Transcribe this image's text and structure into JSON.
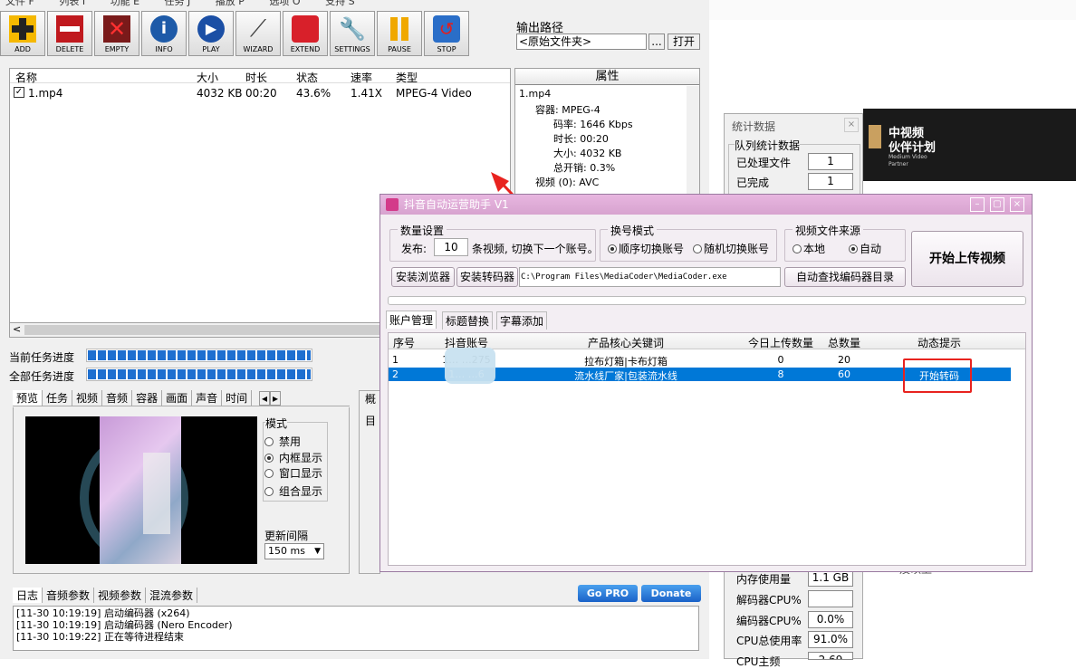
{
  "toolbar": {
    "buttons": [
      "ADD",
      "DELETE",
      "EMPTY",
      "INFO",
      "PLAY",
      "WIZARD",
      "EXTEND",
      "SETTINGS",
      "PAUSE",
      "STOP"
    ]
  },
  "output": {
    "label": "输出路径",
    "value": "<原始文件夹>",
    "browse": "...",
    "open": "打开"
  },
  "files": {
    "headers": [
      "名称",
      "大小",
      "时长",
      "状态",
      "速率",
      "类型"
    ],
    "rows": [
      {
        "name": "1.mp4",
        "size": "4032 KB",
        "duration": "00:20",
        "status": "43.6%",
        "rate": "1.41X",
        "type": "MPEG-4 Video"
      }
    ]
  },
  "props": {
    "title": "属性",
    "tree": [
      "1.mp4",
      "容器: MPEG-4",
      "码率: 1646 Kbps",
      "时长: 00:20",
      "大小: 4032 KB",
      "总开销: 0.3%",
      "视频 (0): AVC"
    ]
  },
  "progress": {
    "current_label": "当前任务进度",
    "total_label": "全部任务进度"
  },
  "tabs": [
    "预览",
    "任务",
    "视频",
    "音频",
    "容器",
    "画面",
    "声音",
    "时间"
  ],
  "mode": {
    "label": "模式",
    "options": [
      "禁用",
      "内框显示",
      "窗口显示",
      "组合显示"
    ],
    "selected": 1,
    "interval_label": "更新间隔",
    "interval": "150 ms"
  },
  "side_tabs": [
    "概",
    "目"
  ],
  "log": {
    "tabs": [
      "日志",
      "音频参数",
      "视频参数",
      "混流参数"
    ],
    "lines": [
      "[11-30 10:19:19] 启动编码器 (x264)",
      "[11-30 10:19:19] 启动编码器 (Nero Encoder)",
      "[11-30 10:19:22] 正在等待进程结束"
    ],
    "gopro": "Go PRO",
    "donate": "Donate"
  },
  "stats": {
    "title": "统计数据",
    "group": "队列统计数据",
    "rows": [
      {
        "label": "已处理文件",
        "value": "1"
      },
      {
        "label": "已完成",
        "value": "1"
      }
    ],
    "rows2": [
      {
        "label": "内存使用量",
        "value": "1.1 GB"
      },
      {
        "label": "解码器CPU%",
        "value": ""
      },
      {
        "label": "编码器CPU%",
        "value": "0.0%"
      },
      {
        "label": "CPU总使用率",
        "value": "91.0%"
      },
      {
        "label": "CPU主频",
        "value": "2.69 GH"
      }
    ]
  },
  "banner": {
    "title": "中视频",
    "subtitle": "伙伴计划",
    "small": "Medium Video Partner"
  },
  "bg_text": "及以上",
  "dialog": {
    "title": "抖音自动运营助手 V1",
    "qty_group": "数量设置",
    "publish_label": "发布:",
    "publish_value": "10",
    "publish_suffix": "条视频, 切换下一个账号。",
    "switch_group": "换号模式",
    "switch_opts": [
      "顺序切换账号",
      "随机切换账号"
    ],
    "source_group": "视频文件来源",
    "source_opts": [
      "本地",
      "自动"
    ],
    "start_btn": "开始上传视频",
    "install_browser": "安装浏览器",
    "install_encoder": "安装转码器",
    "path": "C:\\Program Files\\MediaCoder\\MediaCoder.exe",
    "auto_find": "自动查找编码器目录",
    "tabs": [
      "账户管理",
      "标题替换",
      "字幕添加"
    ],
    "headers": [
      "序号",
      "抖音账号",
      "产品核心关键词",
      "今日上传数量",
      "总数量",
      "动态提示"
    ],
    "rows": [
      {
        "no": "1",
        "account": "1… …275",
        "keyword": "拉布灯箱|卡布灯箱",
        "today": "0",
        "total": "20",
        "hint": ""
      },
      {
        "no": "2",
        "account": "1… …6",
        "keyword": "流水线厂家|包装流水线",
        "today": "8",
        "total": "60",
        "hint": "开始转码"
      }
    ]
  }
}
